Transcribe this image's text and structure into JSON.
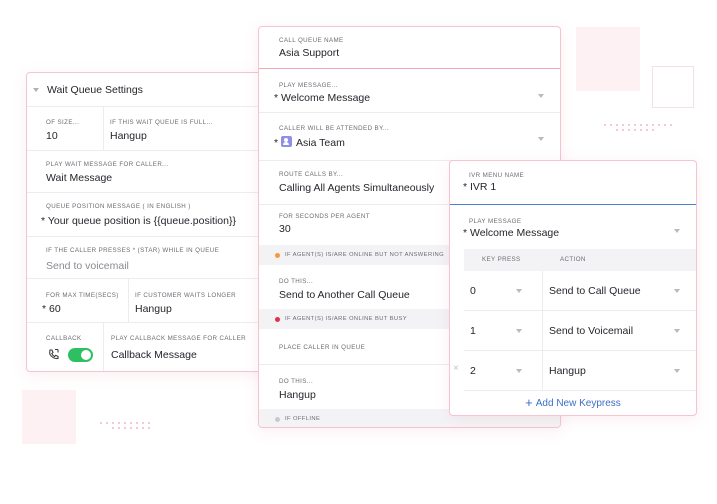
{
  "colors": {
    "accent_pink": "#f4c4cf",
    "toggle_green": "#2fbf63",
    "link_blue": "#3d6fc8",
    "orange_dot": "#f59a3c",
    "red_dot": "#e33145",
    "focus_blue": "#4a7fd6"
  },
  "wait_queue": {
    "title": "Wait Queue Settings",
    "of_size_label": "OF SIZE...",
    "of_size_value": "10",
    "if_full_label": "IF THIS WAIT QUEUE IS FULL...",
    "if_full_value": "Hangup",
    "play_wait_label": "PLAY WAIT MESSAGE FOR CALLER...",
    "play_wait_value": "Wait Message",
    "queue_position_label": "QUEUE POSITION MESSAGE  ( IN ENGLISH )",
    "queue_position_value": "* Your queue position is {{queue.position}}",
    "star_label": "IF THE CALLER PRESSES * (STAR) WHILE IN QUEUE",
    "star_value": "Send to voicemail",
    "max_time_label": "FOR MAX TIME(SECS)",
    "max_time_value": "* 60",
    "waits_longer_label": "IF CUSTOMER WAITS LONGER",
    "waits_longer_value": "Hangup",
    "callback_label": "CALLBACK",
    "callback_enabled": true,
    "callback_msg_label": "PLAY CALLBACK MESSAGE FOR CALLER",
    "callback_msg_value": "Callback Message"
  },
  "call_queue": {
    "name_label": "CALL QUEUE NAME",
    "name_value": "Asia Support",
    "play_label": "PLAY MESSAGE...",
    "play_value": "* Welcome Message",
    "attended_label": "CALLER WILL BE ATTENDED BY...",
    "attended_star": "*",
    "attended_value": "Asia Team",
    "route_label": "ROUTE CALLS BY...",
    "route_value": "Calling All Agents Simultaneously",
    "seconds_label": "FOR SECONDS PER AGENT",
    "seconds_value": "30",
    "not_answering": "IF AGENT(S) IS/ARE ONLINE BUT NOT ANSWERING",
    "do_this_label": "DO THIS...",
    "do_this_value": "Send to Another Call Queue",
    "busy": "IF AGENT(S) IS/ARE ONLINE BUT BUSY",
    "place_label": "PLACE CALLER IN QUEUE",
    "do_this2_label": "DO THIS...",
    "do_this2_value": "Hangup",
    "offline": "IF OFFLINE"
  },
  "ivr": {
    "name_label": "IVR MENU NAME",
    "name_value": "* IVR 1",
    "play_label": "PLAY MESSAGE",
    "play_value": "* Welcome Message",
    "col_key": "KEY PRESS",
    "col_action": "ACTION",
    "rows": [
      {
        "key": "0",
        "action": "Send to Call Queue"
      },
      {
        "key": "1",
        "action": "Send to Voicemail"
      },
      {
        "key": "2",
        "action": "Hangup"
      }
    ],
    "remove_glyph": "×",
    "add_plus": "+",
    "add_label": "Add New Keypress"
  }
}
